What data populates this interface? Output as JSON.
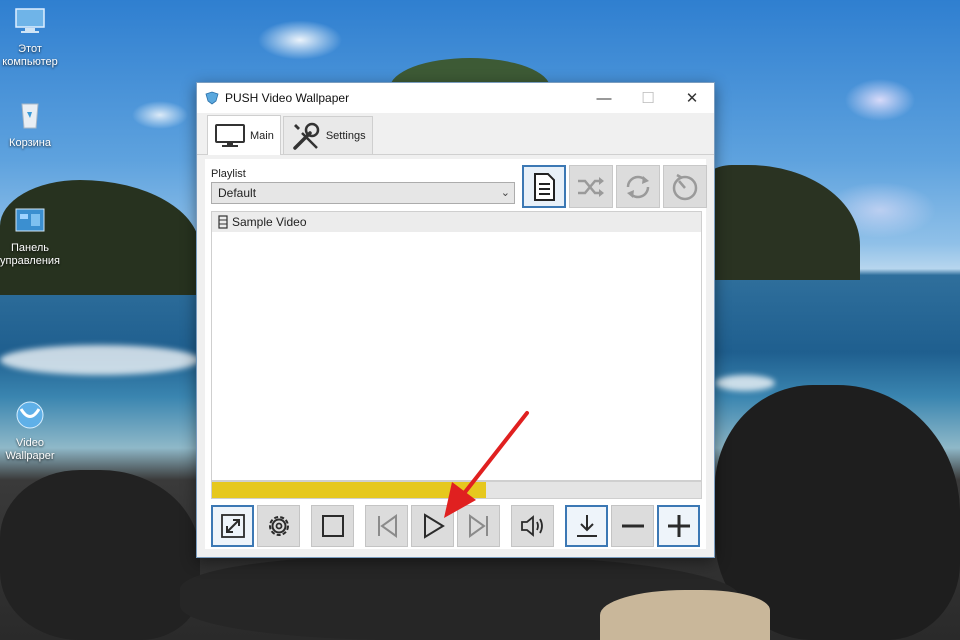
{
  "desktop": {
    "icons": [
      {
        "name": "this-pc",
        "label_line1": "Этот",
        "label_line2": "компьютер"
      },
      {
        "name": "recycle-bin",
        "label_line1": "Корзина",
        "label_line2": ""
      },
      {
        "name": "control-panel",
        "label_line1": "Панель",
        "label_line2": "управления"
      },
      {
        "name": "video-wallpaper",
        "label_line1": "Video",
        "label_line2": "Wallpaper"
      }
    ]
  },
  "window": {
    "title": "PUSH Video Wallpaper",
    "minimize_glyph": "—",
    "maximize_glyph": "☐",
    "close_glyph": "✕"
  },
  "tabs": [
    {
      "label": "Main",
      "active": true,
      "icon": "monitor-icon"
    },
    {
      "label": "Settings",
      "active": false,
      "icon": "tools-icon"
    }
  ],
  "playlist": {
    "label": "Playlist",
    "selected": "Default",
    "chevron": "⌄"
  },
  "playlist_buttons": [
    {
      "name": "playlist-file-button",
      "icon": "document-icon",
      "active": true
    },
    {
      "name": "shuffle-button",
      "icon": "shuffle-icon",
      "active": false
    },
    {
      "name": "repeat-button",
      "icon": "repeat-icon",
      "active": false
    },
    {
      "name": "timer-button",
      "icon": "timer-icon",
      "active": false
    }
  ],
  "videos": [
    {
      "title": "Sample Video"
    }
  ],
  "progress": {
    "percent": 56,
    "color": "#e6c81e"
  },
  "controls": [
    {
      "name": "fullscreen-button",
      "icon": "expand-icon"
    },
    {
      "name": "settings-button",
      "icon": "gear-icon"
    },
    {
      "name": "stop-button",
      "icon": "stop-icon"
    },
    {
      "name": "previous-button",
      "icon": "skip-previous-icon"
    },
    {
      "name": "play-button",
      "icon": "play-icon"
    },
    {
      "name": "next-button",
      "icon": "skip-next-icon"
    },
    {
      "name": "volume-button",
      "icon": "speaker-icon"
    },
    {
      "name": "add-video-button",
      "icon": "download-icon"
    },
    {
      "name": "remove-video-button",
      "icon": "minus-icon"
    },
    {
      "name": "add-button",
      "icon": "plus-icon"
    }
  ],
  "colors": {
    "accent": "#3c78b4",
    "annotation": "#e02020"
  }
}
